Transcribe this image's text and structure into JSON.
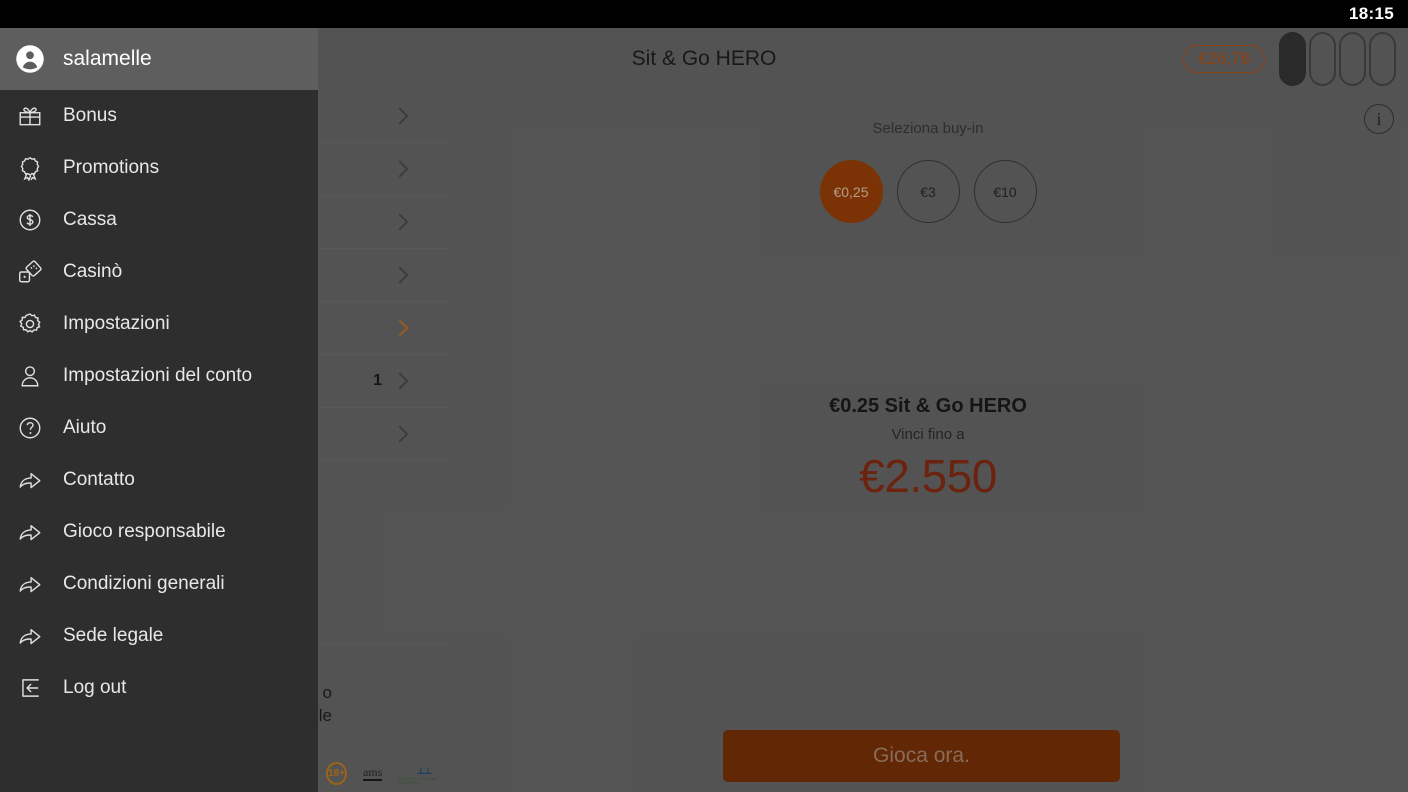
{
  "statusbar": {
    "clock": "18:15"
  },
  "header": {
    "title": "Sit & Go HERO",
    "balance": "€26,78",
    "tables": [
      {
        "name": "table-slot-1",
        "filled": true
      },
      {
        "name": "table-slot-2",
        "filled": false
      },
      {
        "name": "table-slot-3",
        "filled": false
      },
      {
        "name": "table-slot-4",
        "filled": false
      }
    ]
  },
  "background_list": {
    "rows": [
      {
        "count": "",
        "accent": false
      },
      {
        "count": "",
        "accent": false
      },
      {
        "count": "",
        "accent": false
      },
      {
        "count": "",
        "accent": false
      },
      {
        "count": "",
        "accent": true
      },
      {
        "count": "1",
        "accent": false
      },
      {
        "count": "",
        "accent": false
      }
    ],
    "footer_text_line1": "o",
    "footer_text_line2": "le",
    "age_badge": "18+",
    "ams_logo": "ams",
    "agcm_mark": "⫠⫠",
    "agcm_sub": "AGENZIA DOGANE MONOPOLI"
  },
  "main": {
    "info_icon_label": "i",
    "buyin_label": "Seleziona buy-in",
    "buyins": [
      {
        "label": "€0,25",
        "selected": true
      },
      {
        "label": "€3",
        "selected": false
      },
      {
        "label": "€10",
        "selected": false
      }
    ],
    "prize_title": "€0.25 Sit & Go HERO",
    "prize_subtitle": "Vinci fino a",
    "prize_amount": "€2.550",
    "play_button": "Gioca ora."
  },
  "drawer": {
    "username": "salamelle",
    "items": [
      {
        "label": "Bonus",
        "icon": "gift-icon"
      },
      {
        "label": "Promotions",
        "icon": "award-icon"
      },
      {
        "label": "Cassa",
        "icon": "dollar-circle-icon"
      },
      {
        "label": "Casinò",
        "icon": "dice-icon"
      },
      {
        "label": "Impostazioni",
        "icon": "gear-icon"
      },
      {
        "label": "Impostazioni del conto",
        "icon": "person-icon"
      },
      {
        "label": "Aiuto",
        "icon": "question-circle-icon"
      },
      {
        "label": "Contatto",
        "icon": "external-arrow-icon"
      },
      {
        "label": "Gioco responsabile",
        "icon": "external-arrow-icon"
      },
      {
        "label": "Condizioni generali",
        "icon": "external-arrow-icon"
      },
      {
        "label": "Sede legale",
        "icon": "external-arrow-icon"
      },
      {
        "label": "Log out",
        "icon": "logout-icon"
      }
    ]
  },
  "colors": {
    "accent_orange": "#b5561a",
    "chip_selected": "#9e4208",
    "prize_red": "#8a2e14",
    "play_button": "#7e3206",
    "drawer_bg": "#2e2e2e",
    "page_bg": "#6b6b6b"
  }
}
